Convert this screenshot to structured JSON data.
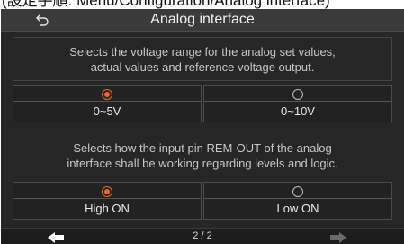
{
  "breadcrumb": "(設定手順: Menu/Configuration/Analog interface)",
  "header": {
    "title": "Analog interface"
  },
  "sections": [
    {
      "description_lines": [
        "Selects the voltage range for the analog set values,",
        "actual values and reference voltage output."
      ],
      "options": [
        {
          "label": "0~5V",
          "selected": true
        },
        {
          "label": "0~10V",
          "selected": false
        }
      ]
    },
    {
      "description_lines": [
        "Selects how the input pin REM-OUT of the analog",
        "interface shall be working regarding levels and logic."
      ],
      "options": [
        {
          "label": "High ON",
          "selected": true
        },
        {
          "label": "Low ON",
          "selected": false
        }
      ]
    }
  ],
  "footer": {
    "page_indicator": "2 / 2"
  },
  "colors": {
    "accent": "#f06a1a",
    "background": "#262626",
    "text": "#e8e8e8"
  },
  "icons": {
    "back": "back-arrow-icon",
    "prev": "left-arrow-icon",
    "next": "right-arrow-icon"
  }
}
